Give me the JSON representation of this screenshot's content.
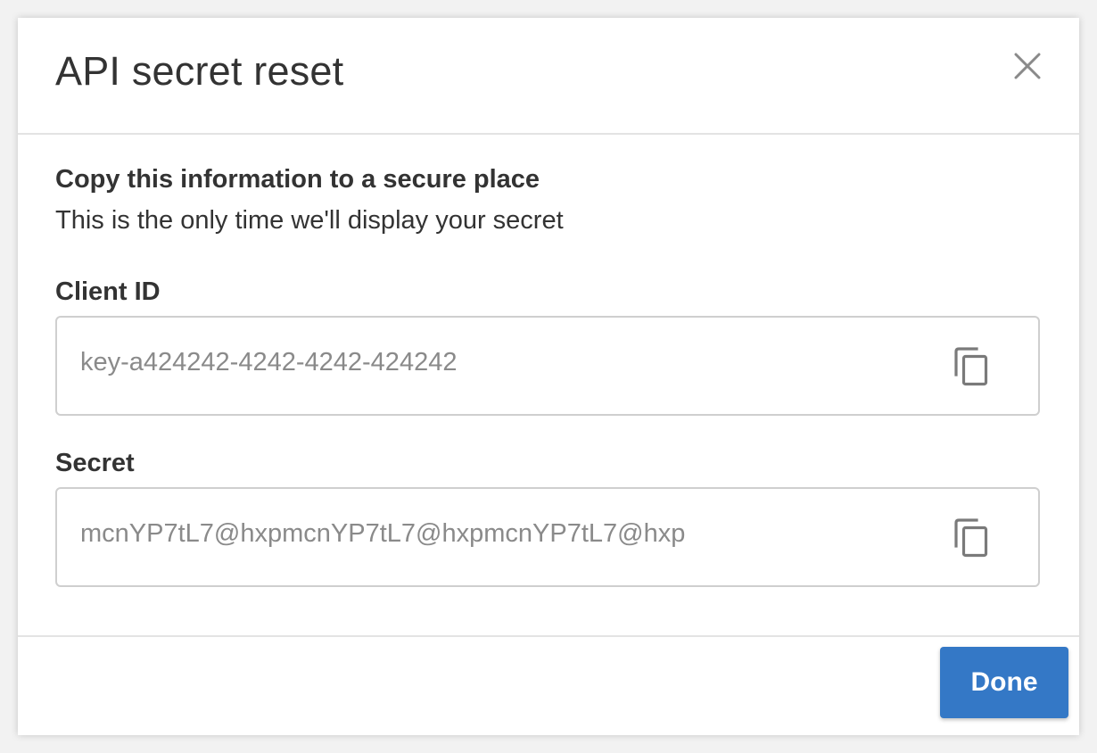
{
  "modal": {
    "title": "API secret reset",
    "close_icon": "close-icon"
  },
  "notice": {
    "title": "Copy this information to a secure place",
    "subtitle": "This is the only time we'll display your secret"
  },
  "fields": {
    "client_id": {
      "label": "Client ID",
      "value": "key-a424242-4242-4242-424242",
      "copy_icon": "copy-icon"
    },
    "secret": {
      "label": "Secret",
      "value": "mcnYP7tL7@hxpmcnYP7tL7@hxpmcnYP7tL7@hxp",
      "copy_icon": "copy-icon"
    }
  },
  "footer": {
    "done_label": "Done"
  },
  "colors": {
    "primary_button": "#3478c6",
    "text": "#333333",
    "muted_text": "#8a8a8a",
    "border": "#cfcfcf"
  }
}
